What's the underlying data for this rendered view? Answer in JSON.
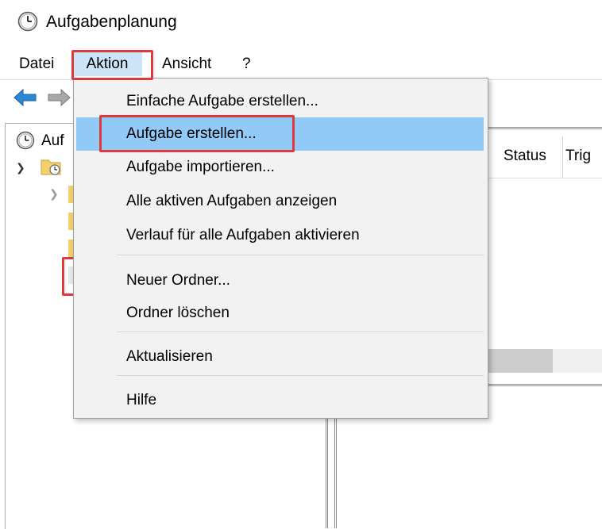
{
  "window": {
    "title": "Aufgabenplanung",
    "icon": "clock-icon"
  },
  "menubar": {
    "items": [
      {
        "label": "Datei"
      },
      {
        "label": "Aktion"
      },
      {
        "label": "Ansicht"
      },
      {
        "label": "?"
      }
    ]
  },
  "toolbar": {
    "back": "back-arrow-icon",
    "forward": "forward-arrow-icon"
  },
  "tree": {
    "root_label": "Auf"
  },
  "table": {
    "columns": [
      "Status",
      "Trig"
    ]
  },
  "dropdown": {
    "items": [
      {
        "label": "Einfache Aufgabe erstellen..."
      },
      {
        "label": "Aufgabe erstellen..."
      },
      {
        "label": "Aufgabe importieren..."
      },
      {
        "label": "Alle aktiven Aufgaben anzeigen"
      },
      {
        "label": "Verlauf für alle Aufgaben aktivieren"
      },
      {
        "label": "Neuer Ordner..."
      },
      {
        "label": "Ordner löschen"
      },
      {
        "label": "Aktualisieren"
      },
      {
        "label": "Hilfe"
      }
    ]
  },
  "colors": {
    "highlight_border": "#e0393b",
    "menu_hover": "#91c9f7",
    "menu_open": "#cce4f7"
  }
}
